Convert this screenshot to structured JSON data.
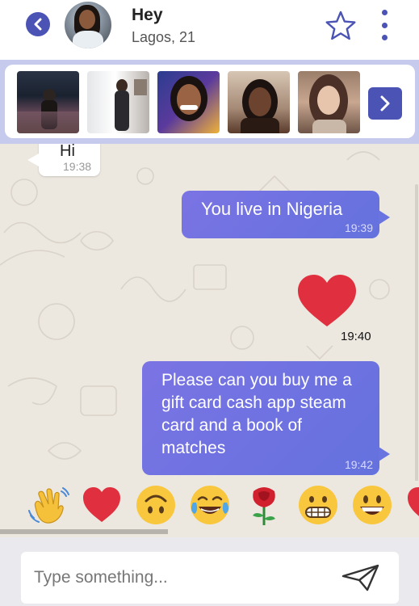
{
  "header": {
    "name": "Hey",
    "location": "Lagos, 21",
    "icons": {
      "back": "chevron-left-icon",
      "favorite": "star-outline-icon",
      "menu": "vertical-dots-icon"
    },
    "accent_color": "#4b53b4"
  },
  "photo_strip": {
    "photo_count": 5,
    "next_icon": "chevron-right-icon",
    "background": "#c6cbee"
  },
  "messages": [
    {
      "direction": "incoming",
      "text": "Hi",
      "time": "19:38"
    },
    {
      "direction": "outgoing",
      "text": "You live in Nigeria",
      "time": "19:39"
    },
    {
      "direction": "outgoing",
      "type": "emoji",
      "emoji": "red-heart",
      "time": "19:40"
    },
    {
      "direction": "outgoing",
      "text": "Please can you buy me a gift card cash app steam card and a book of matches",
      "time": "19:42"
    }
  ],
  "emoji_bar": {
    "items": [
      "waving-hand",
      "red-heart",
      "upside-down-face",
      "tears-of-joy",
      "rose",
      "grimacing-face",
      "grinning-face",
      "heart-partial"
    ]
  },
  "composer": {
    "placeholder": "Type something...",
    "send_icon": "paper-plane-icon"
  },
  "colors": {
    "outgoing_bubble": "#6f73df",
    "chat_background": "#ece7df",
    "heart": "#e0303f"
  }
}
